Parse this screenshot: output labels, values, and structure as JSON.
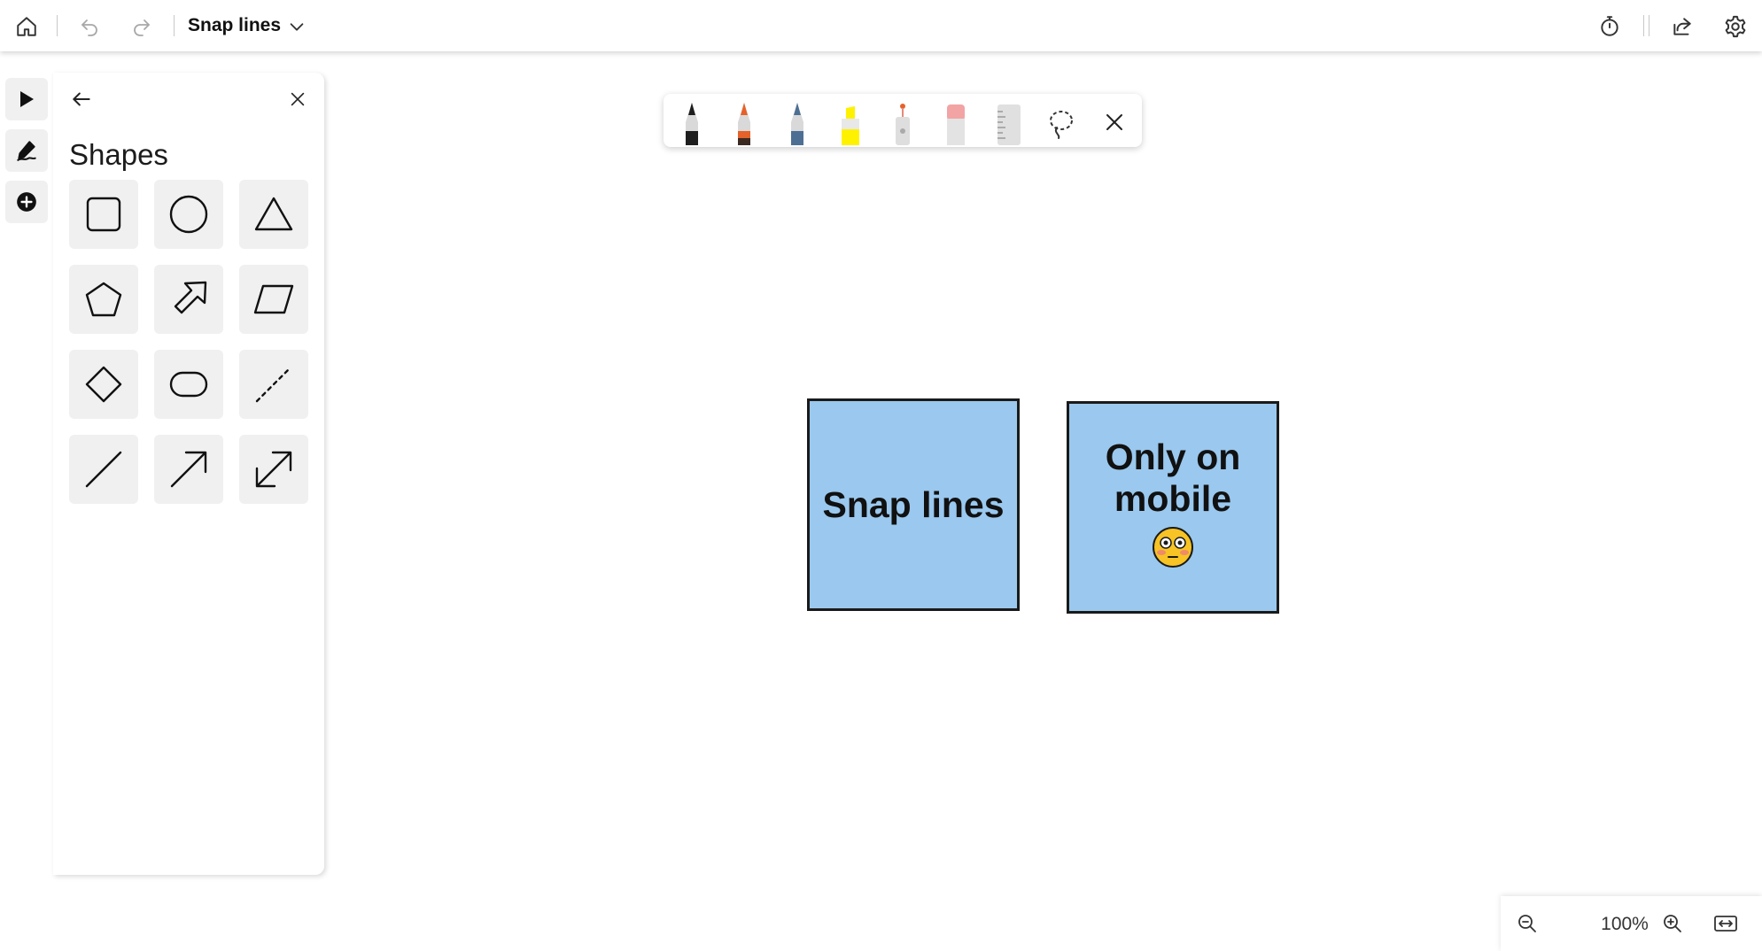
{
  "titlebar": {
    "document_title": "Snap lines",
    "icons": [
      "home-icon",
      "undo-icon",
      "redo-icon",
      "chevron-down-icon",
      "timer-icon",
      "share-icon",
      "gear-icon"
    ]
  },
  "rail": {
    "items": [
      "select-arrow-icon",
      "pen-sign-icon",
      "add-circle-icon"
    ]
  },
  "shapes_panel": {
    "title": "Shapes",
    "shapes": [
      "square",
      "circle",
      "triangle",
      "pentagon",
      "arrow-block",
      "parallelogram",
      "diamond",
      "rounded-rectangle",
      "dashed-line",
      "line",
      "arrow",
      "double-arrow"
    ]
  },
  "ink_toolbar": {
    "tools": [
      "black-pen",
      "orange-pen",
      "blue-pen",
      "yellow-highlighter",
      "laser-pointer",
      "eraser",
      "ruler",
      "lasso-select",
      "close"
    ],
    "colors": {
      "black": "#1e1e1e",
      "orange": "#e5622a",
      "blue": "#4d6f94",
      "yellow": "#fff200",
      "eraser": "#f2a3a3"
    }
  },
  "canvas": {
    "notes": [
      {
        "text": "Snap lines",
        "color": "#9ac8ee"
      },
      {
        "text": "Only on mobile",
        "emoji": "😳",
        "color": "#9ac8ee"
      }
    ]
  },
  "zoom": {
    "level": "100%"
  }
}
